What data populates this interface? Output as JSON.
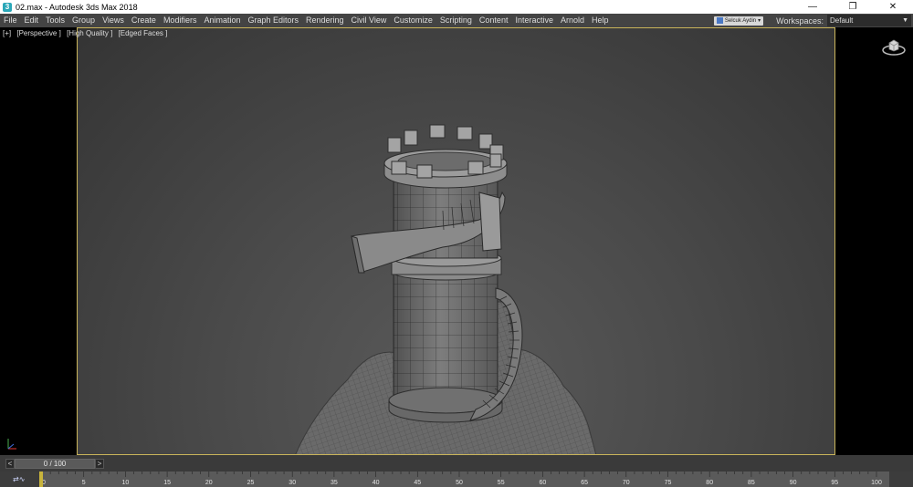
{
  "window": {
    "title": "02.max - Autodesk 3ds Max 2018",
    "app_icon_glyph": "3",
    "minimize_glyph": "—",
    "maximize_glyph": "❐",
    "close_glyph": "✕"
  },
  "menu": {
    "items": [
      "File",
      "Edit",
      "Tools",
      "Group",
      "Views",
      "Create",
      "Modifiers",
      "Animation",
      "Graph Editors",
      "Rendering",
      "Civil View",
      "Customize",
      "Scripting",
      "Content",
      "Interactive",
      "Arnold",
      "Help"
    ],
    "user": "Selcuk Aydin",
    "workspaces_label": "Workspaces:",
    "workspace_value": "Default"
  },
  "viewport": {
    "labels": [
      "[+]",
      "[Perspective ]",
      "[High Quality ]",
      "[Edged Faces ]"
    ],
    "background_color": "#4a4a4a",
    "border_color": "#c9b45a",
    "icons": [
      "viewcube-icon",
      "axis-tripod-icon"
    ]
  },
  "timeline": {
    "prev_glyph": "<",
    "next_glyph": ">",
    "frame_display": "0 / 100",
    "current_frame": 0,
    "ticks": [
      "0",
      "5",
      "10",
      "15",
      "20",
      "25",
      "30",
      "35",
      "40",
      "45",
      "50",
      "55",
      "60",
      "65",
      "70",
      "75",
      "80",
      "85",
      "90",
      "95",
      "100"
    ],
    "curve_editor_glyph": "⇄∿",
    "marker_color": "#c8b43c"
  }
}
